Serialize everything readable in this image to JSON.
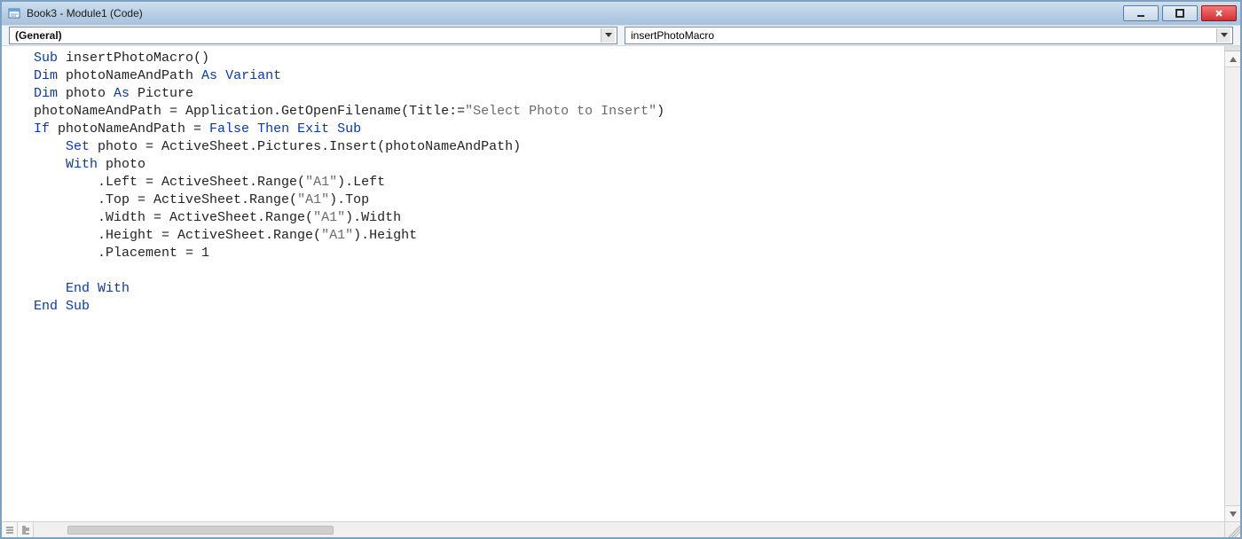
{
  "titlebar": {
    "title": "Book3 - Module1 (Code)"
  },
  "dropdowns": {
    "object": "(General)",
    "procedure": "insertPhotoMacro"
  },
  "code": {
    "tokens": [
      [
        [
          "kw",
          "Sub"
        ],
        [
          "",
          " insertPhotoMacro()"
        ]
      ],
      [
        [
          "kw",
          "Dim"
        ],
        [
          "",
          " photoNameAndPath "
        ],
        [
          "kw",
          "As"
        ],
        [
          "",
          " "
        ],
        [
          "kw",
          "Variant"
        ]
      ],
      [
        [
          "kw",
          "Dim"
        ],
        [
          "",
          " photo "
        ],
        [
          "kw",
          "As"
        ],
        [
          "",
          " Picture"
        ]
      ],
      [
        [
          "",
          "photoNameAndPath = Application.GetOpenFilename(Title:="
        ],
        [
          "str",
          "\"Select Photo to Insert\""
        ],
        [
          "",
          ")"
        ]
      ],
      [
        [
          "kw",
          "If"
        ],
        [
          "",
          " photoNameAndPath = "
        ],
        [
          "kw",
          "False"
        ],
        [
          "",
          " "
        ],
        [
          "kw",
          "Then"
        ],
        [
          "",
          " "
        ],
        [
          "kw",
          "Exit Sub"
        ]
      ],
      [
        [
          "",
          "    "
        ],
        [
          "kw",
          "Set"
        ],
        [
          "",
          " photo = ActiveSheet.Pictures.Insert(photoNameAndPath)"
        ]
      ],
      [
        [
          "",
          "    "
        ],
        [
          "kw",
          "With"
        ],
        [
          "",
          " photo"
        ]
      ],
      [
        [
          "",
          "        .Left = ActiveSheet.Range("
        ],
        [
          "str",
          "\"A1\""
        ],
        [
          "",
          ").Left"
        ]
      ],
      [
        [
          "",
          "        .Top = ActiveSheet.Range("
        ],
        [
          "str",
          "\"A1\""
        ],
        [
          "",
          ").Top"
        ]
      ],
      [
        [
          "",
          "        .Width = ActiveSheet.Range("
        ],
        [
          "str",
          "\"A1\""
        ],
        [
          "",
          ").Width"
        ]
      ],
      [
        [
          "",
          "        .Height = ActiveSheet.Range("
        ],
        [
          "str",
          "\"A1\""
        ],
        [
          "",
          ").Height"
        ]
      ],
      [
        [
          "",
          "        .Placement = "
        ],
        [
          "num",
          "1"
        ]
      ],
      [
        [
          "",
          ""
        ]
      ],
      [
        [
          "",
          "    "
        ],
        [
          "kw",
          "End With"
        ]
      ],
      [
        [
          "kw",
          "End Sub"
        ]
      ]
    ]
  }
}
